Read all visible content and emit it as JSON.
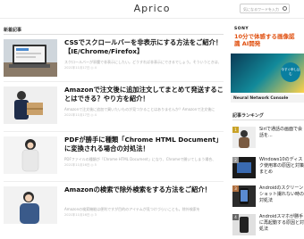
{
  "header": {
    "site_title": "Aprico",
    "search_placeholder": "気になるワードを入力"
  },
  "main": {
    "section_title": "新着記事",
    "articles": [
      {
        "title": "CSSでスクロールバーを非表示にする方法をご紹介！【IE/Chrome/Firefox】",
        "snippet": "スクロールバーが邪魔で非表示にしたい。どうすれば非表示にできるでしょう。そういうときは、",
        "meta": "2021年11月17日 ◎ 4"
      },
      {
        "title": "Amazonで注文後に追加注文してまとめて発送することはできる？やり方を紹介！",
        "snippet": "Amazonで注文後に追加で買いたいものが見つかることはありませんか？Amazonで注文後に",
        "meta": "2021年11月17日 ◎ 4"
      },
      {
        "title": "PDFが勝手に種類「Chrome HTML Document」に変換される場合の対処法！",
        "snippet": "PDFファイルの種類が「Chrome HTML Document」になり、Chromeで開いてしまう場合、",
        "meta": "2021年11月16日 ◎ 5"
      },
      {
        "title": "Amazonの検索で除外検索をする方法をご紹介！",
        "snippet": "Amazonの検索機能は便利ですが目的のアイテムが見つけづらいことも。除外検索を",
        "meta": "2021年11月16日 ◎ 3"
      }
    ]
  },
  "ad": {
    "brand": "SONY",
    "headline": "10分で体感する画像認識 AI開発",
    "cta": "今すぐ申し込む",
    "caption": "Neural Network Console"
  },
  "sidebar": {
    "ranking_title": "記事ランキング",
    "items": [
      {
        "rank": "1",
        "text": "Siriで通話の画面で会話を..."
      },
      {
        "rank": "2",
        "text": "Windows10のディスク使用率の原因と対策まとめ"
      },
      {
        "rank": "3",
        "text": "Androidのスクリーンショット撮れない時の対処法"
      },
      {
        "rank": "4",
        "text": "Androidスマホが勝手に再起動する原因と対処法"
      }
    ]
  },
  "colors": {
    "accent": "#e05010",
    "ad_teal": "#0a7fa0"
  }
}
